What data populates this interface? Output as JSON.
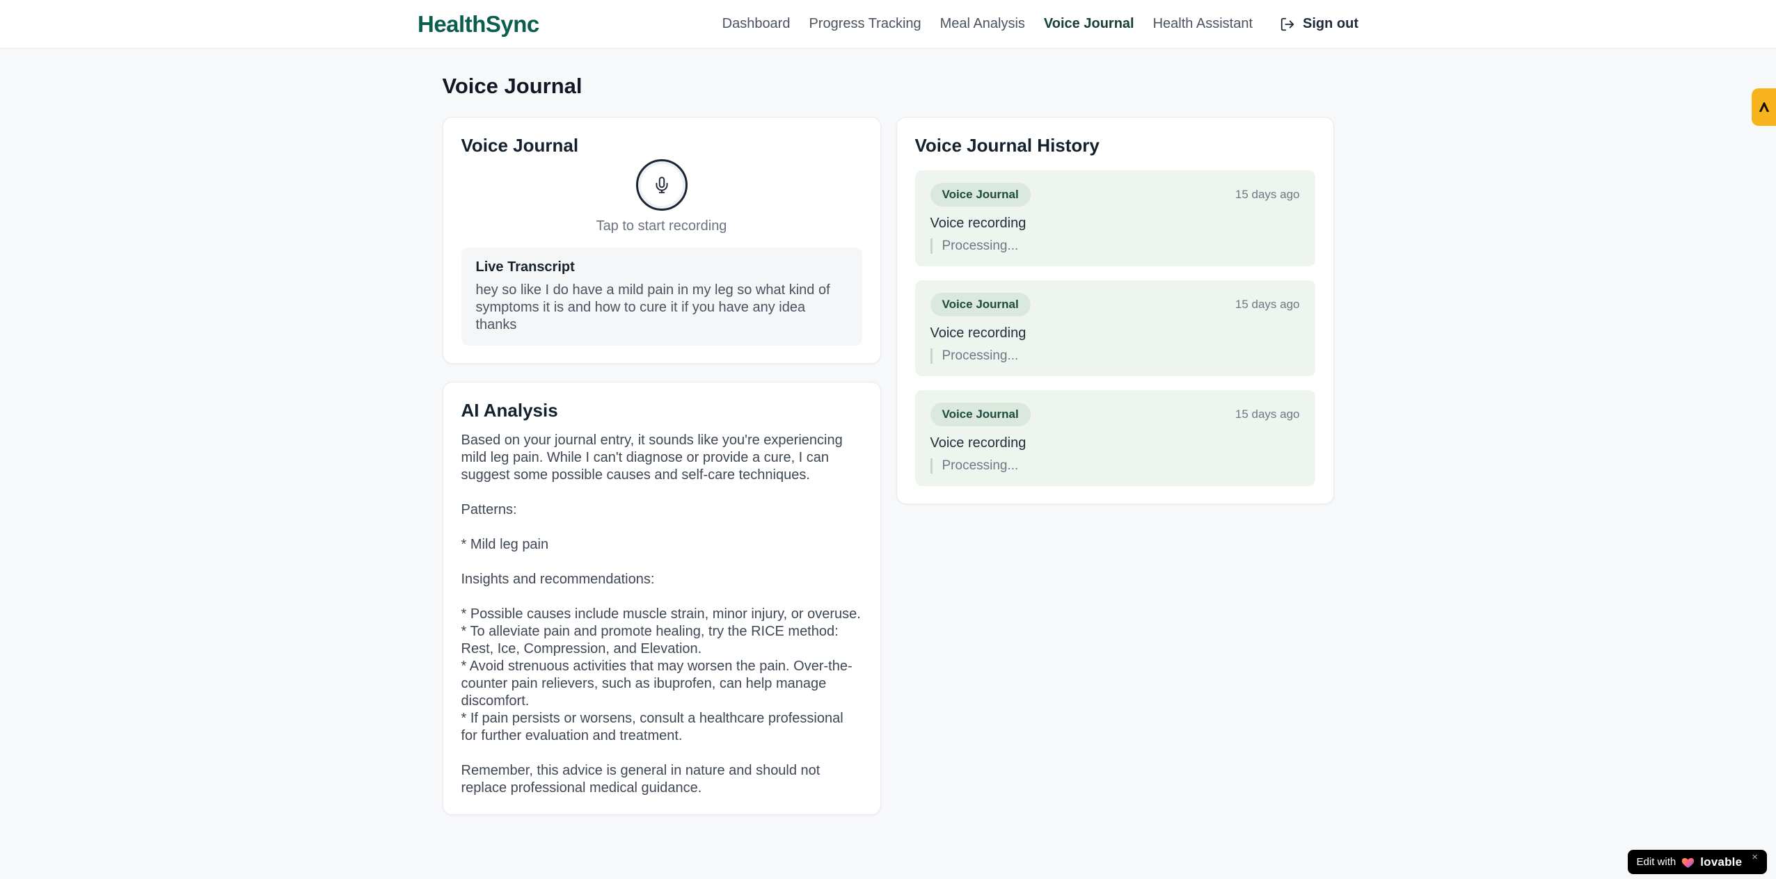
{
  "colors": {
    "brand": "#0b5d4e",
    "nav_active": "#173f39",
    "entry_bg": "#eef5ef",
    "badge_bg": "#dbe8de",
    "badge_text": "#1d4b3e",
    "side_tab_bg": "#f6b31b",
    "mic_ring": "#1b2432"
  },
  "brand": {
    "name": "HealthSync"
  },
  "nav": {
    "items": [
      {
        "label": "Dashboard",
        "active": false
      },
      {
        "label": "Progress Tracking",
        "active": false
      },
      {
        "label": "Meal Analysis",
        "active": false
      },
      {
        "label": "Voice Journal",
        "active": true
      },
      {
        "label": "Health Assistant",
        "active": false
      }
    ],
    "sign_out_label": "Sign out",
    "sign_out_icon": "logout-icon"
  },
  "page": {
    "title": "Voice Journal"
  },
  "recorder_card": {
    "title": "Voice Journal",
    "mic_icon": "microphone-icon",
    "tap_hint": "Tap to start recording",
    "live_transcript": {
      "title": "Live Transcript",
      "text": "hey so like I do have a mild pain in my leg so what kind of symptoms it is and how to cure it if you have any idea thanks"
    }
  },
  "analysis_card": {
    "title": "AI Analysis",
    "text": "Based on your journal entry, it sounds like you're experiencing mild leg pain. While I can't diagnose or provide a cure, I can suggest some possible causes and self-care techniques.\n\nPatterns:\n\n* Mild leg pain\n\nInsights and recommendations:\n\n* Possible causes include muscle strain, minor injury, or overuse.\n* To alleviate pain and promote healing, try the RICE method: Rest, Ice, Compression, and Elevation.\n* Avoid strenuous activities that may worsen the pain. Over-the-counter pain relievers, such as ibuprofen, can help manage discomfort.\n* If pain persists or worsens, consult a healthcare professional for further evaluation and treatment.\n\nRemember, this advice is general in nature and should not replace professional medical guidance."
  },
  "history_card": {
    "title": "Voice Journal History",
    "entries": [
      {
        "badge": "Voice Journal",
        "time": "15 days ago",
        "title": "Voice recording",
        "status": "Processing..."
      },
      {
        "badge": "Voice Journal",
        "time": "15 days ago",
        "title": "Voice recording",
        "status": "Processing..."
      },
      {
        "badge": "Voice Journal",
        "time": "15 days ago",
        "title": "Voice recording",
        "status": "Processing..."
      }
    ]
  },
  "side_tab": {
    "icon": "peak-logo-icon"
  },
  "edit_badge": {
    "prefix": "Edit with",
    "brand": "lovable",
    "close": "×",
    "heart_icon": "lovable-heart-icon"
  }
}
